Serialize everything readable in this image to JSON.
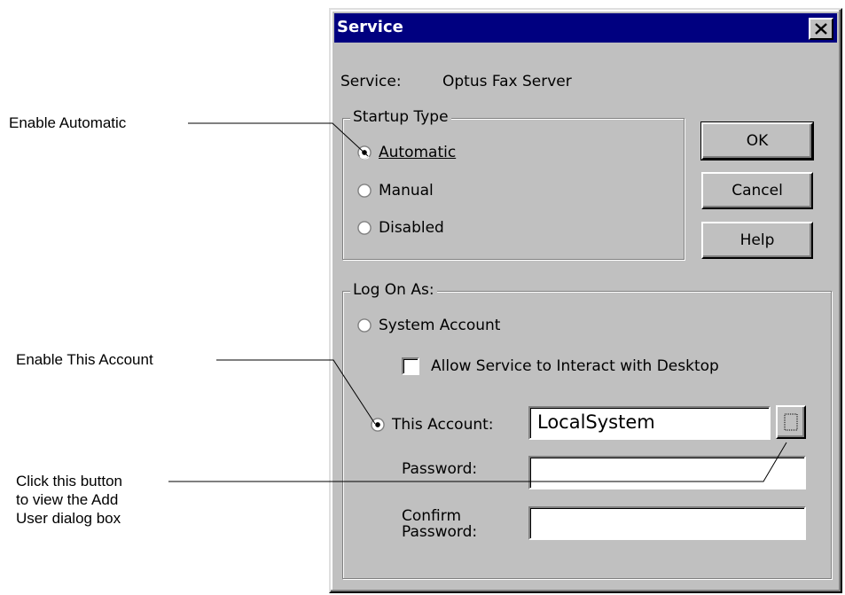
{
  "annotations": {
    "enable_automatic": "Enable Automatic",
    "enable_this_account": "Enable This Account",
    "click_button_line1": "Click this button",
    "click_button_line2": "to view the Add",
    "click_button_line3": "User dialog box"
  },
  "dialog": {
    "title": "Service",
    "service_label": "Service:",
    "service_name": "Optus Fax Server",
    "startup_type": {
      "legend": "Startup Type",
      "options": [
        {
          "label": "Automatic",
          "selected": true
        },
        {
          "label": "Manual",
          "selected": false
        },
        {
          "label": "Disabled",
          "selected": false
        }
      ]
    },
    "buttons": {
      "ok": "OK",
      "cancel": "Cancel",
      "help": "Help"
    },
    "log_on": {
      "legend": "Log On As:",
      "system_account": "System Account",
      "allow_interact": "Allow Service to Interact with Desktop",
      "allow_interact_checked": false,
      "this_account": "This Account:",
      "this_account_value": "LocalSystem",
      "password_label": "Password:",
      "password_value": "",
      "confirm_label_line1": "Confirm",
      "confirm_label_line2": "Password:",
      "confirm_value": "",
      "selected": "this_account"
    }
  },
  "colors": {
    "titlebar": "#000080",
    "dialog_face": "#c0c0c0"
  },
  "icons": {
    "close": "close-icon",
    "browse": "browse-ellipsis-icon"
  }
}
